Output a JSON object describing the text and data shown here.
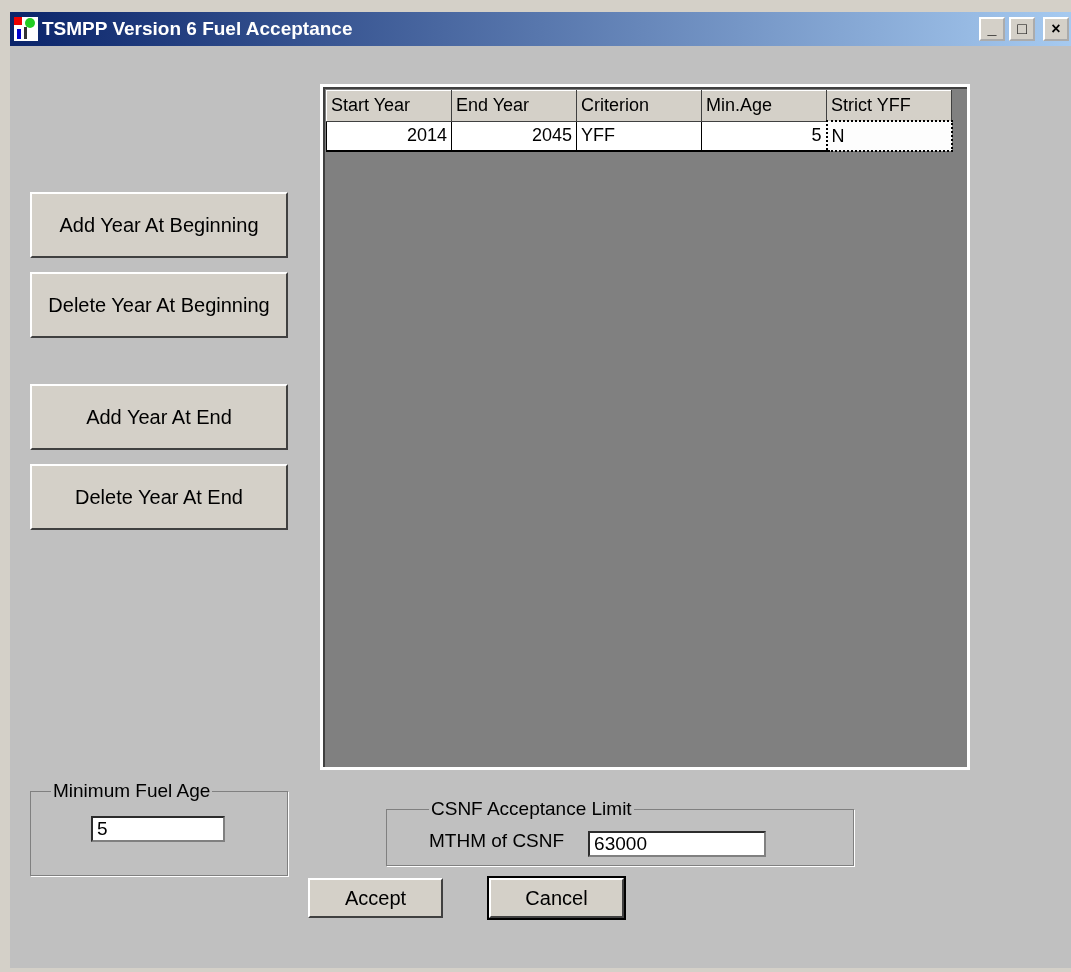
{
  "window": {
    "title": "TSMPP Version 6 Fuel Acceptance",
    "controls": [
      "_",
      "□",
      "×"
    ]
  },
  "buttons_left": [
    {
      "label": "Add Year At Beginning"
    },
    {
      "label": "Delete Year At Beginning"
    },
    {
      "label": "Add Year At End"
    },
    {
      "label": "Delete Year At End"
    }
  ],
  "table": {
    "columns": [
      {
        "label": "Start Year"
      },
      {
        "label": "End Year"
      },
      {
        "label": "Criterion"
      },
      {
        "label": "Min.Age"
      },
      {
        "label": "Strict YFF"
      }
    ],
    "rows": [
      {
        "cells": [
          {
            "text": "2014",
            "focused": false
          },
          {
            "text": "2045",
            "focused": false
          },
          {
            "text": "YFF",
            "focused": false
          },
          {
            "text": "5",
            "focused": false
          },
          {
            "text": "N",
            "focused": true
          }
        ]
      }
    ]
  },
  "minimum_fuel_age": {
    "legend": "Minimum Fuel Age",
    "value": "5"
  },
  "csnf_limit": {
    "legend": "CSNF Acceptance Limit",
    "label": "MTHM of CSNF",
    "value": "63000"
  },
  "actions": [
    {
      "label": "Accept",
      "default": false
    },
    {
      "label": "Cancel",
      "default": true
    }
  ]
}
